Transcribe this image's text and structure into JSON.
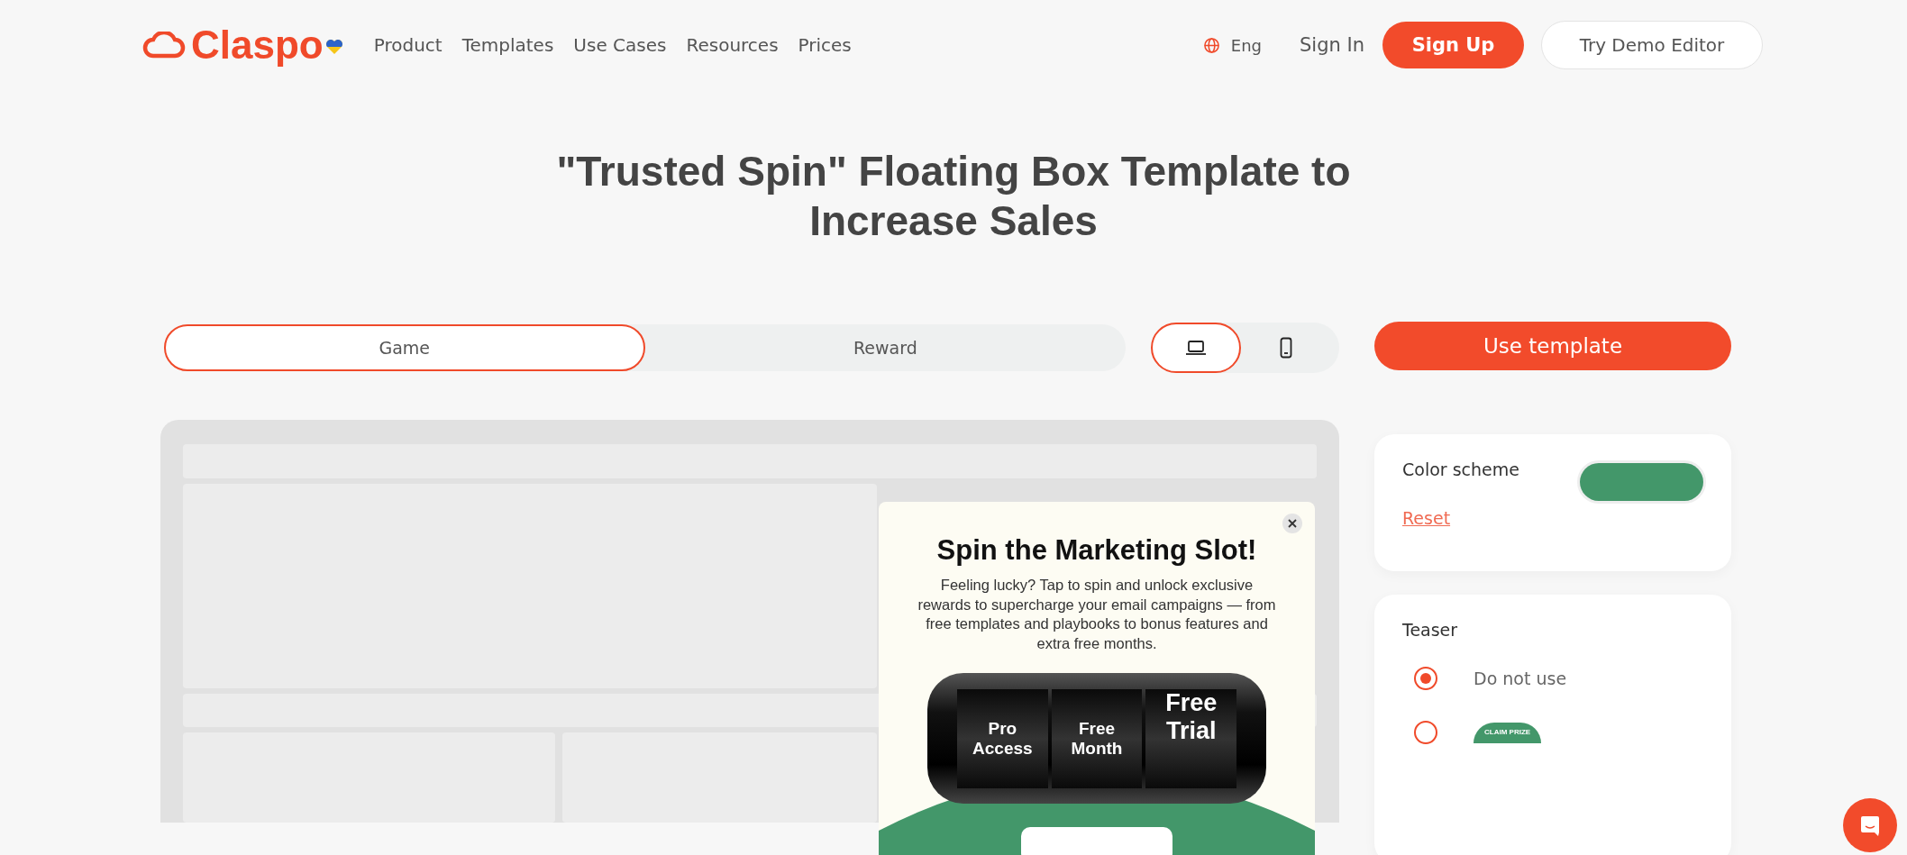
{
  "header": {
    "logo": "Claspo",
    "nav": [
      "Product",
      "Templates",
      "Use Cases",
      "Resources",
      "Prices"
    ],
    "language": "Eng",
    "sign_in": "Sign In",
    "sign_up": "Sign Up",
    "demo": "Try Demo Editor"
  },
  "title": "\"Trusted Spin\" Floating Box Template to Increase Sales",
  "tabs": [
    {
      "label": "Game",
      "selected": true
    },
    {
      "label": "Reward",
      "selected": false
    }
  ],
  "devices": [
    {
      "kind": "laptop",
      "selected": true
    },
    {
      "kind": "phone",
      "selected": false
    }
  ],
  "use_template": "Use template",
  "popup": {
    "title": "Spin the Marketing Slot!",
    "text": "Feeling lucky? Tap to spin and unlock exclusive rewards to supercharge your email campaigns — from free templates and playbooks to bonus features and extra free months.",
    "reels": [
      "Pro Access",
      "Free Month",
      "Free Trial"
    ]
  },
  "color_scheme": {
    "label": "Color scheme",
    "color": "#43976a",
    "reset": "Reset"
  },
  "teaser": {
    "label": "Teaser",
    "options": [
      {
        "kind": "text",
        "label": "Do not use",
        "selected": true
      },
      {
        "kind": "preview",
        "label": "CLAIM PRIZE",
        "selected": false
      }
    ]
  }
}
